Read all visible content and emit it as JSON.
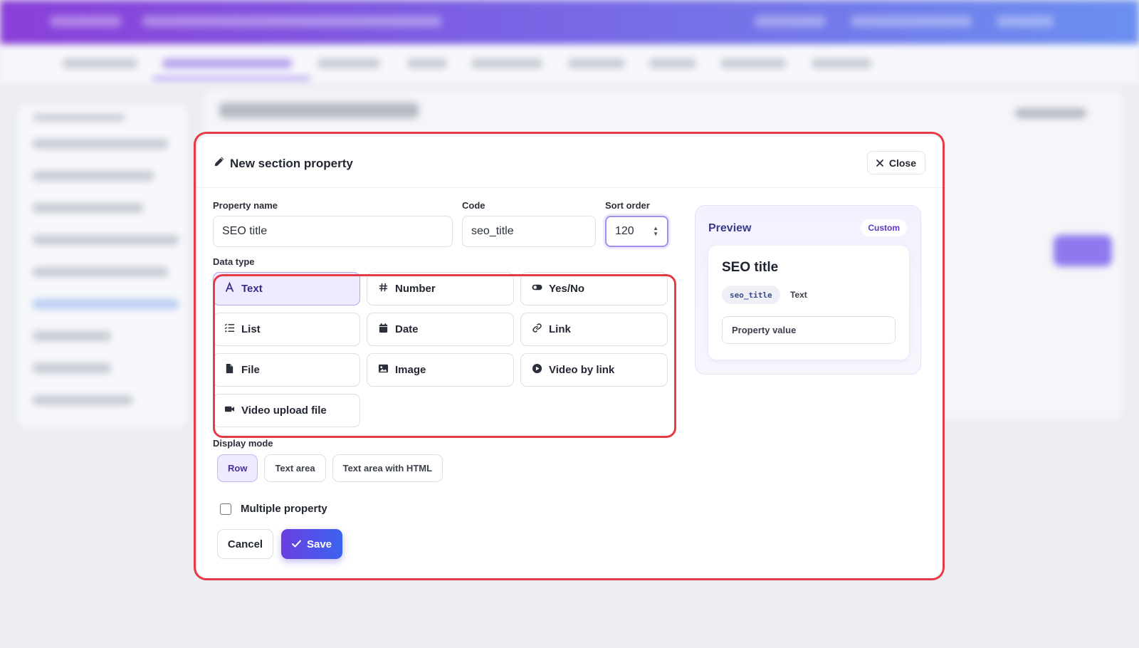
{
  "modal": {
    "title": "New section property",
    "close_label": "Close",
    "fields": {
      "property_name": {
        "label": "Property name",
        "value": "SEO title"
      },
      "code": {
        "label": "Code",
        "value": "seo_title"
      },
      "sort_order": {
        "label": "Sort order",
        "value": "120"
      }
    },
    "data_type": {
      "label": "Data type",
      "selected": "Text",
      "options": [
        {
          "label": "Text",
          "icon": "text-icon"
        },
        {
          "label": "Number",
          "icon": "hash-icon"
        },
        {
          "label": "Yes/No",
          "icon": "toggle-icon"
        },
        {
          "label": "List",
          "icon": "list-icon"
        },
        {
          "label": "Date",
          "icon": "calendar-icon"
        },
        {
          "label": "Link",
          "icon": "link-icon"
        },
        {
          "label": "File",
          "icon": "file-icon"
        },
        {
          "label": "Image",
          "icon": "image-icon"
        },
        {
          "label": "Video by link",
          "icon": "play-circle-icon"
        },
        {
          "label": "Video upload file",
          "icon": "video-camera-icon"
        }
      ]
    },
    "display_mode": {
      "label": "Display mode",
      "selected": "Row",
      "options": [
        "Row",
        "Text area",
        "Text area with HTML"
      ]
    },
    "multiple_property": {
      "label": "Multiple property",
      "checked": false
    },
    "cancel_label": "Cancel",
    "save_label": "Save",
    "preview": {
      "title": "Preview",
      "badge": "Custom",
      "name": "SEO title",
      "code": "seo_title",
      "type": "Text",
      "value_placeholder": "Property value"
    }
  },
  "colors": {
    "accent": "#6a3fe0",
    "highlight": "#e53b47",
    "selected_bg": "#efeaff"
  }
}
